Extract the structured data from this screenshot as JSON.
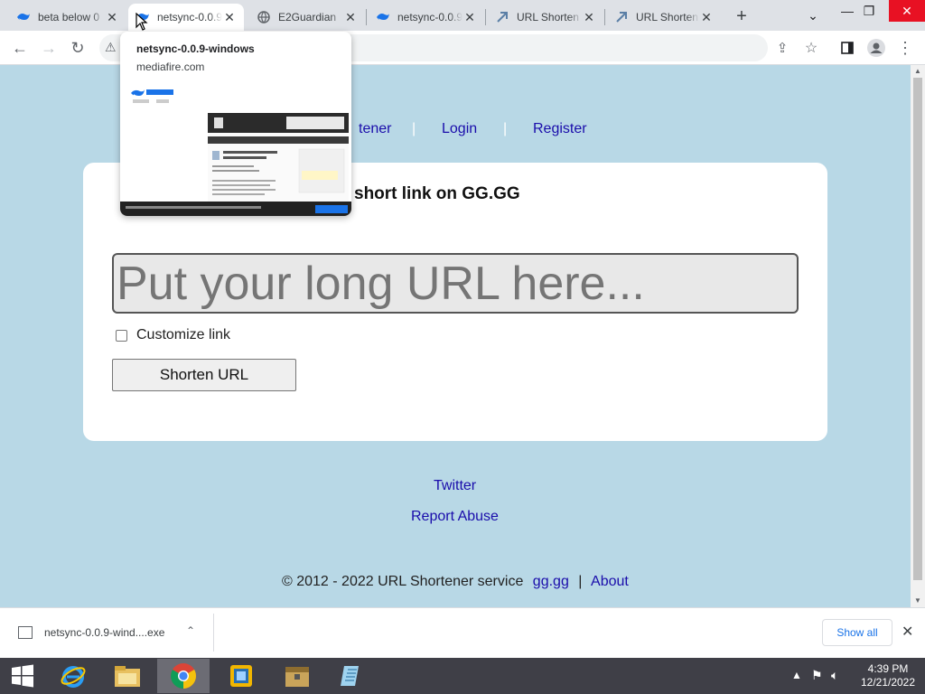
{
  "tabs": [
    {
      "title": "beta below 0",
      "active": false
    },
    {
      "title": "netsync-0.0.9",
      "active": true
    },
    {
      "title": "E2Guardian",
      "active": false
    },
    {
      "title": "netsync-0.0.9",
      "active": false
    },
    {
      "title": "URL Shorten",
      "active": false
    },
    {
      "title": "URL Shorten",
      "active": false
    }
  ],
  "hovercard": {
    "title": "netsync-0.0.9-windows",
    "domain": "mediafire.com",
    "logo": "MediaFire"
  },
  "page": {
    "nav": {
      "shortener_partial": "tener",
      "sep": "|",
      "login": "Login",
      "register": "Register"
    },
    "heading_partial": "short link on GG.GG",
    "url_placeholder": "Put your long URL here...",
    "customize_label": "Customize link",
    "shorten_button": "Shorten URL",
    "footer": {
      "twitter": "Twitter",
      "report": "Report Abuse",
      "copyright": "© 2012 - 2022 URL Shortener service",
      "gg": "gg.gg",
      "sep": "|",
      "about": "About"
    }
  },
  "download": {
    "filename": "netsync-0.0.9-wind....exe",
    "show_all": "Show all"
  },
  "taskbar": {
    "time": "4:39 PM",
    "date": "12/21/2022"
  },
  "colors": {
    "page_bg": "#b8d8e6",
    "link": "#1a0dab",
    "tabstrip": "#dee1e6",
    "taskbar": "#3f3f47"
  }
}
